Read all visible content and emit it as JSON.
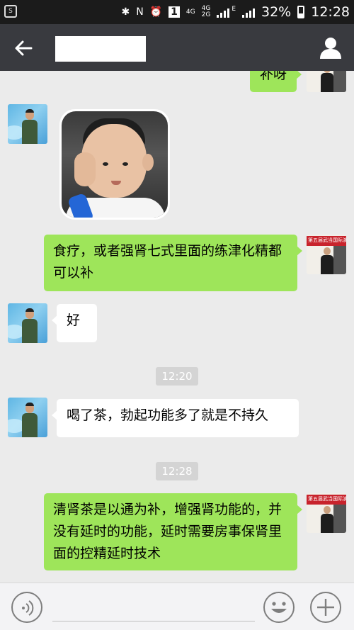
{
  "status_bar": {
    "network_4g": "4G",
    "lte_label": "4G",
    "secondary_label": "2G",
    "e_label": "E",
    "sim_slot": "1",
    "battery": "32%",
    "time": "12:28"
  },
  "header": {
    "title": ""
  },
  "messages": [
    {
      "id": "m0",
      "side": "out",
      "text": "补呀"
    },
    {
      "id": "m1",
      "side": "in",
      "type": "image"
    },
    {
      "id": "m2",
      "side": "out",
      "text": "食疗，或者强肾七式里面的练津化精都可以补"
    },
    {
      "id": "m3",
      "side": "in",
      "text": "好"
    },
    {
      "id": "t1",
      "type": "time",
      "text": "12:20"
    },
    {
      "id": "m4",
      "side": "in",
      "text": "喝了茶，勃起功能多了就是不持久"
    },
    {
      "id": "t2",
      "type": "time",
      "text": "12:28"
    },
    {
      "id": "m5",
      "side": "out",
      "text": "清肾茶是以通为补，增强肾功能的，并没有延时的功能，延时需要房事保肾里面的控精延时技术"
    }
  ],
  "avatar_right_banner": "第五届武当国际演武大",
  "icons": {
    "back": "back-arrow-icon",
    "profile": "person-icon",
    "voice": "voice-icon",
    "emoji": "emoji-icon",
    "plus": "plus-icon"
  }
}
